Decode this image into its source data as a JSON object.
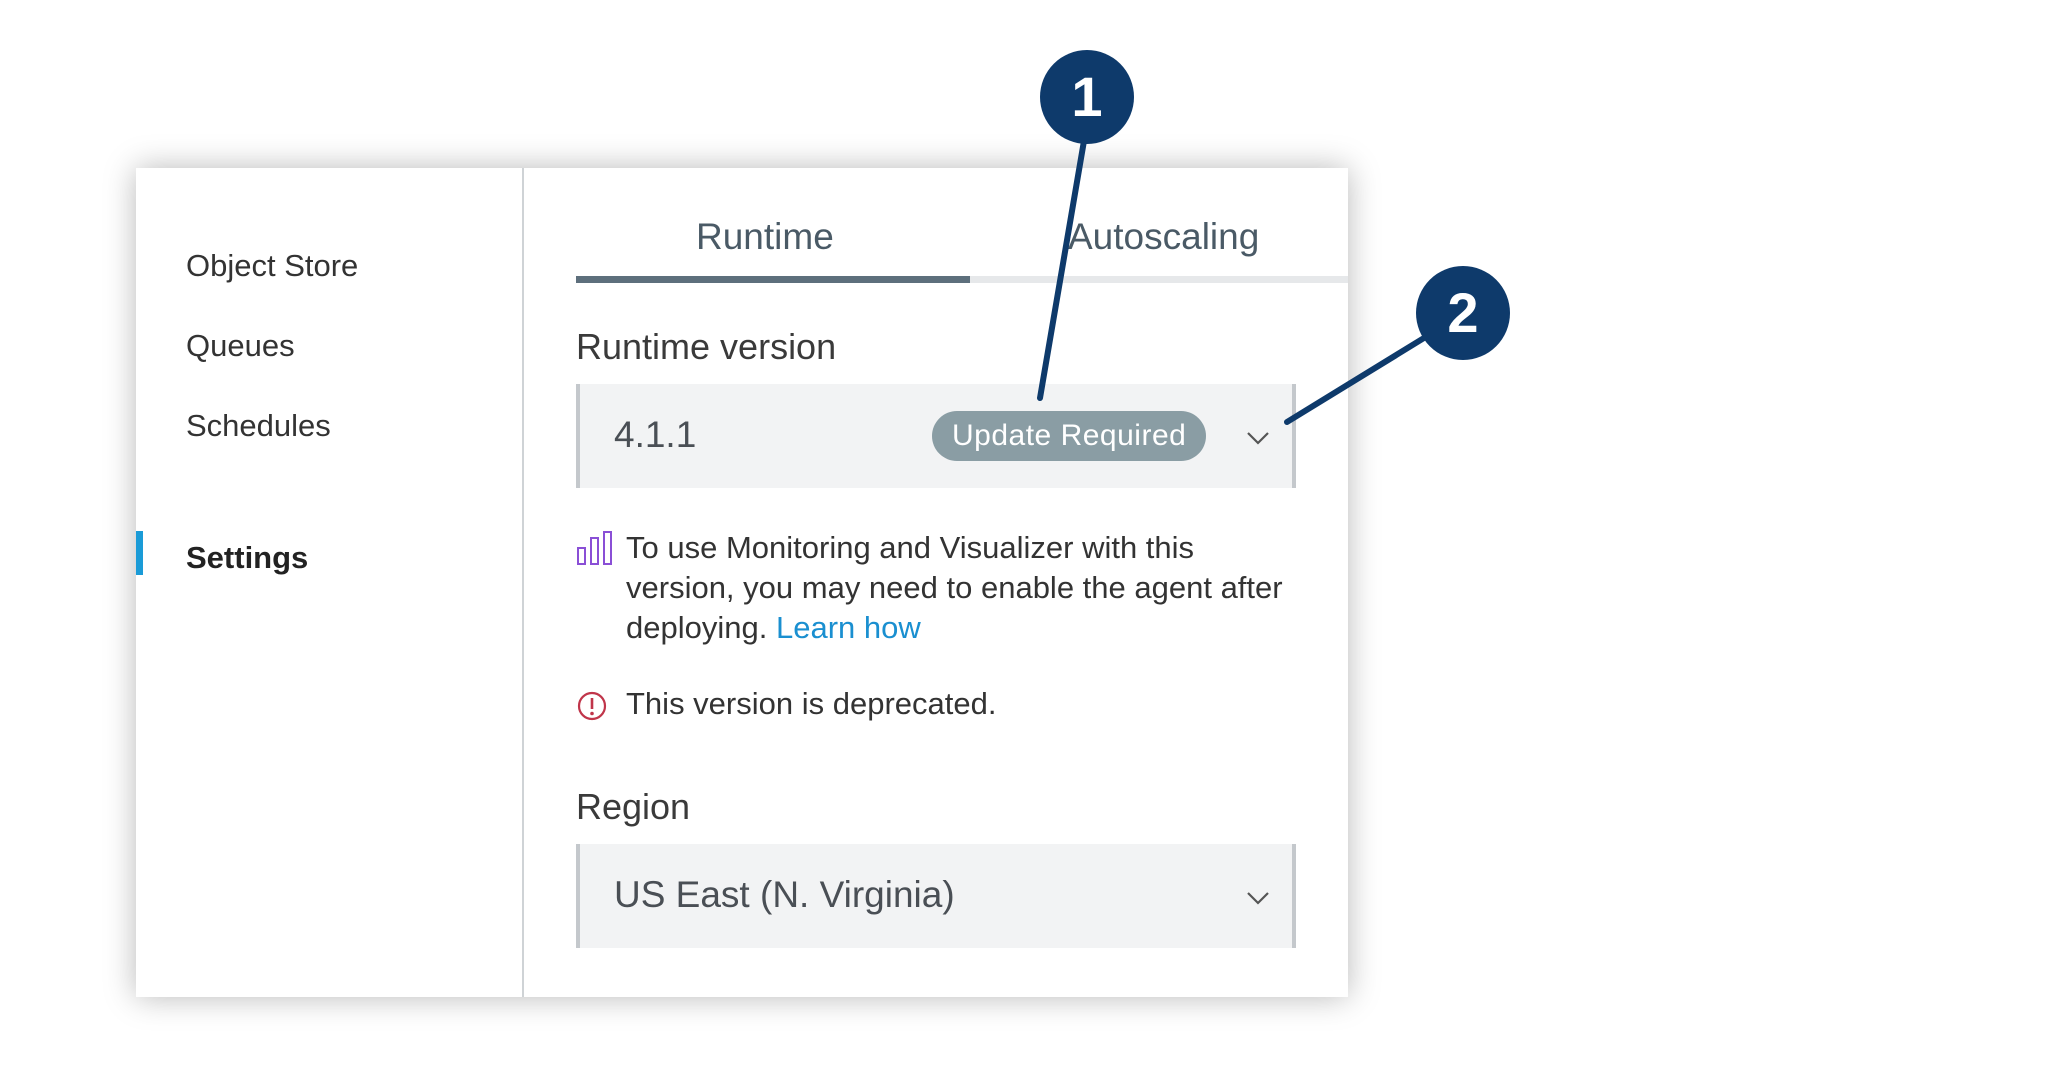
{
  "sidebar": {
    "items": [
      {
        "label": "Object Store",
        "active": false
      },
      {
        "label": "Queues",
        "active": false
      },
      {
        "label": "Schedules",
        "active": false
      },
      {
        "label": "Settings",
        "active": true
      }
    ],
    "active_color": "#1a9bd7"
  },
  "tabs": [
    {
      "label": "Runtime",
      "active": true
    },
    {
      "label": "Autoscaling",
      "active": false
    }
  ],
  "runtime": {
    "label": "Runtime version",
    "value": "4.1.1",
    "badge": "Update Required",
    "chevron_icon": "chevron-down-icon"
  },
  "info": {
    "icon": "bar-chart-icon",
    "text": "To use Monitoring and Visualizer with this version, you may need to enable the agent after deploying.",
    "link": "Learn how"
  },
  "warning": {
    "icon": "alert-circle-icon",
    "text": "This version is deprecated."
  },
  "region": {
    "label": "Region",
    "value": "US East (N. Virginia)",
    "chevron_icon": "chevron-down-icon"
  },
  "callouts": [
    "1",
    "2"
  ],
  "colors": {
    "callout": "#0e3a6b",
    "badge": "#8a9da4",
    "link": "#1a8fd0",
    "warning": "#c0354a",
    "chart_icon": "#8a4fd6"
  }
}
